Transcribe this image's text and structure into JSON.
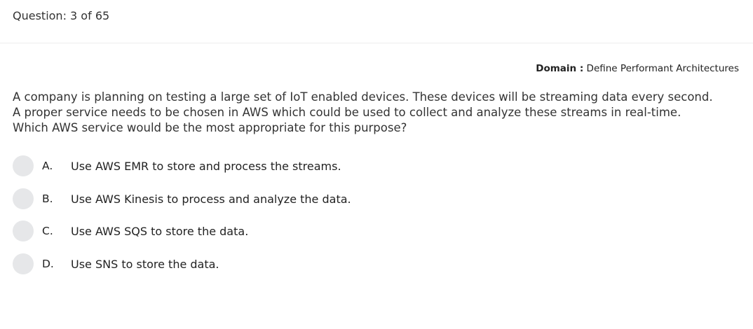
{
  "header": {
    "question_counter": "Question: 3 of 65"
  },
  "domain": {
    "label": "Domain :",
    "value": "Define Performant Architectures"
  },
  "question": {
    "text": "A company is planning on testing a large set of IoT enabled devices. These devices will be streaming data every second. A proper service needs to be chosen in AWS which could be used to collect and analyze these streams in real-time. Which AWS service would be the most appropriate for this purpose?"
  },
  "options": [
    {
      "letter": "A.",
      "text": "Use AWS EMR to store and process the streams."
    },
    {
      "letter": "B.",
      "text": "Use AWS Kinesis to process and analyze the data."
    },
    {
      "letter": "C.",
      "text": "Use AWS SQS to store the data."
    },
    {
      "letter": "D.",
      "text": "Use SNS to store the data."
    }
  ],
  "colors": {
    "radio_fill": "#e6e7e9",
    "text": "#333333"
  }
}
